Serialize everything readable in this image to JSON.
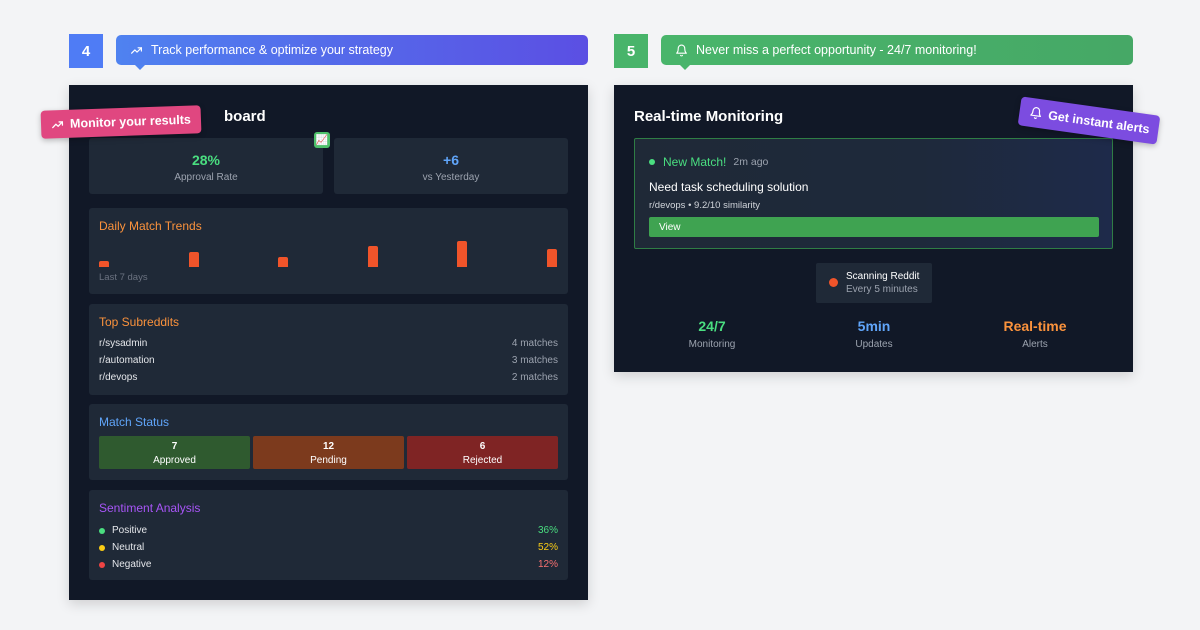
{
  "step4": {
    "number": "4",
    "banner": "Track performance & optimize your strategy",
    "tag": "Monitor your results",
    "panel_title": "board",
    "badge_emoji": "📈",
    "stats": [
      {
        "value": "28%",
        "label": "Approval Rate",
        "color": "#4ade80"
      },
      {
        "value": "+6",
        "label": "vs Yesterday",
        "color": "#60a5fa"
      }
    ],
    "trends": {
      "title": "Daily Match Trends",
      "caption": "Last 7 days",
      "bars": [
        1,
        2.5,
        1.6,
        3.4,
        4.2,
        2.9
      ]
    },
    "subreddits": {
      "title": "Top Subreddits",
      "rows": [
        {
          "name": "r/sysadmin",
          "count": "4 matches"
        },
        {
          "name": "r/automation",
          "count": "3 matches"
        },
        {
          "name": "r/devops",
          "count": "2 matches"
        }
      ]
    },
    "match_status": {
      "title": "Match Status",
      "items": [
        {
          "num": "7",
          "label": "Approved",
          "color": "#2f5a2f"
        },
        {
          "num": "12",
          "label": "Pending",
          "color": "#7c3a1d"
        },
        {
          "num": "6",
          "label": "Rejected",
          "color": "#7f2424"
        }
      ]
    },
    "sentiment": {
      "title": "Sentiment Analysis",
      "rows": [
        {
          "label": "Positive",
          "pct": "36%",
          "dot": "#4ade80",
          "color": "#4ade80"
        },
        {
          "label": "Neutral",
          "pct": "52%",
          "dot": "#facc15",
          "color": "#facc15"
        },
        {
          "label": "Negative",
          "pct": "12%",
          "dot": "#ef4444",
          "color": "#f87171"
        }
      ]
    }
  },
  "step5": {
    "number": "5",
    "banner": "Never miss a perfect opportunity - 24/7 monitoring!",
    "tag": "Get instant alerts",
    "panel_title": "Real-time Monitoring",
    "match": {
      "status": "New Match!",
      "time": "2m ago",
      "title": "Need task scheduling solution",
      "meta": "r/devops • 9.2/10 similarity",
      "button": "View"
    },
    "scan": {
      "title": "Scanning Reddit",
      "sub": "Every 5 minutes"
    },
    "stats": [
      {
        "value": "24/7",
        "label": "Monitoring",
        "color": "#4ade80"
      },
      {
        "value": "5min",
        "label": "Updates",
        "color": "#60a5fa"
      },
      {
        "value": "Real-time",
        "label": "Alerts",
        "color": "#fb923c"
      }
    ]
  }
}
